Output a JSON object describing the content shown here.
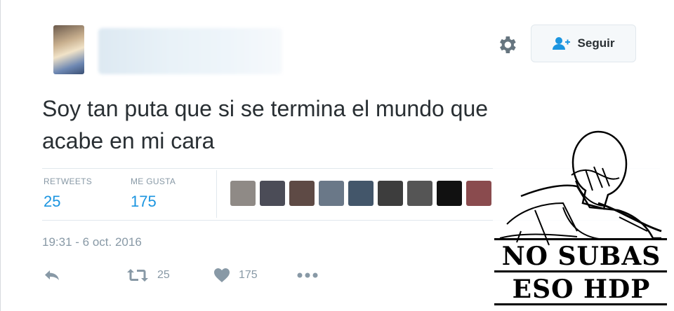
{
  "header": {
    "follow_label": "Seguir",
    "icons": {
      "gear": "gear-icon",
      "follow": "add-user-icon"
    }
  },
  "tweet": {
    "text_line1": "Soy tan puta que si se termina el mundo que",
    "text_line2": "acabe en mi cara",
    "timestamp": "19:31 - 6 oct. 2016"
  },
  "stats": {
    "retweets_label": "RETWEETS",
    "retweets_value": "25",
    "likes_label": "ME GUSTA",
    "likes_value": "175"
  },
  "actions": {
    "retweet_count": "25",
    "like_count": "175",
    "icons": [
      "reply-icon",
      "retweet-icon",
      "heart-icon",
      "more-icon"
    ]
  },
  "likers": [
    {
      "color": "#8f8a86"
    },
    {
      "color": "#4b4c57"
    },
    {
      "color": "#5e4a45"
    },
    {
      "color": "#6a7888"
    },
    {
      "color": "#43566a"
    },
    {
      "color": "#3d3d3d"
    },
    {
      "color": "#555555"
    },
    {
      "color": "#111111"
    },
    {
      "color": "#8a4b4e"
    }
  ],
  "meme": {
    "line1": "NO SUBAS",
    "line2": "ESO HDP"
  },
  "colors": {
    "accent": "#1b95e0",
    "muted": "#8899a6",
    "text": "#292f33"
  }
}
